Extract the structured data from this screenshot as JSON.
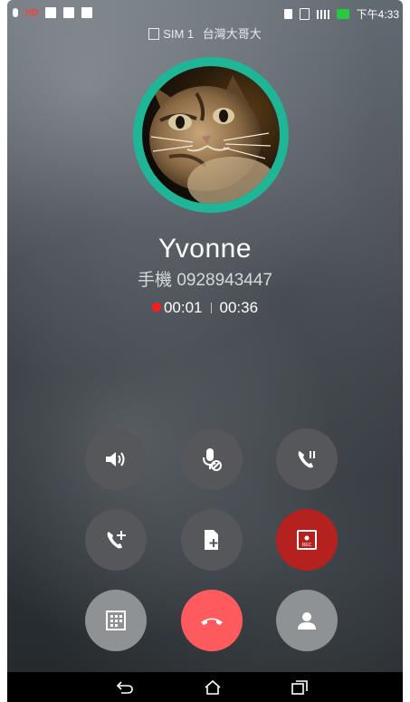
{
  "status_bar": {
    "hd_label": "HD",
    "time": "下午4:33"
  },
  "sim": {
    "label": "SIM 1",
    "carrier": "台灣大哥大"
  },
  "caller": {
    "name": "Yvonne",
    "phone_type": "手機",
    "phone_number": "0928943447"
  },
  "call": {
    "recording_time": "00:01",
    "call_time": "00:36"
  },
  "controls": {
    "row1": [
      "speaker-icon",
      "mute-icon",
      "hold-icon"
    ],
    "row2": [
      "add-call-icon",
      "add-note-icon",
      "record-icon"
    ],
    "row3": [
      "dialpad-icon",
      "end-call-icon",
      "contact-icon"
    ]
  },
  "colors": {
    "ring": "#1fb597",
    "record": "#b5211f",
    "end_call": "#ff5b5f"
  }
}
